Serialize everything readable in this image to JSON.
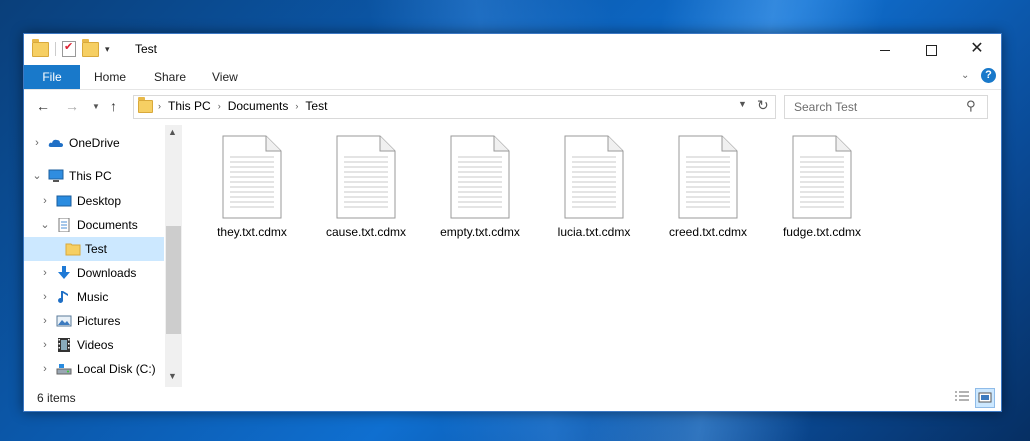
{
  "window": {
    "title": "Test"
  },
  "window_controls": {
    "minimize": "minimize",
    "maximize": "maximize",
    "close": "✕"
  },
  "ribbon": {
    "tabs": [
      "File",
      "Home",
      "Share",
      "View"
    ],
    "help": "?"
  },
  "address": {
    "crumbs": [
      "This PC",
      "Documents",
      "Test"
    ]
  },
  "search": {
    "placeholder": "Search Test"
  },
  "navpane": {
    "items": [
      {
        "label": "OneDrive",
        "icon": "cloud-icon",
        "expanded": false
      },
      {
        "label": "This PC",
        "icon": "computer-icon",
        "expanded": true
      },
      {
        "label": "Desktop",
        "icon": "desktop-icon",
        "expanded": false
      },
      {
        "label": "Documents",
        "icon": "documents-icon",
        "expanded": true
      },
      {
        "label": "Test",
        "icon": "folder-icon",
        "selected": true
      },
      {
        "label": "Downloads",
        "icon": "download-icon",
        "expanded": false
      },
      {
        "label": "Music",
        "icon": "music-icon",
        "expanded": false
      },
      {
        "label": "Pictures",
        "icon": "pictures-icon",
        "expanded": false
      },
      {
        "label": "Videos",
        "icon": "videos-icon",
        "expanded": false
      },
      {
        "label": "Local Disk (C:)",
        "icon": "disk-icon",
        "expanded": false
      }
    ]
  },
  "files": [
    {
      "name": "they.txt.cdmx"
    },
    {
      "name": "cause.txt.cdmx"
    },
    {
      "name": "empty.txt.cdmx"
    },
    {
      "name": "lucia.txt.cdmx"
    },
    {
      "name": "creed.txt.cdmx"
    },
    {
      "name": "fudge.txt.cdmx"
    }
  ],
  "status": {
    "count": "6 items"
  },
  "colors": {
    "accent": "#1979ca",
    "selection": "#cce8ff",
    "folder": "#f6cf63"
  }
}
